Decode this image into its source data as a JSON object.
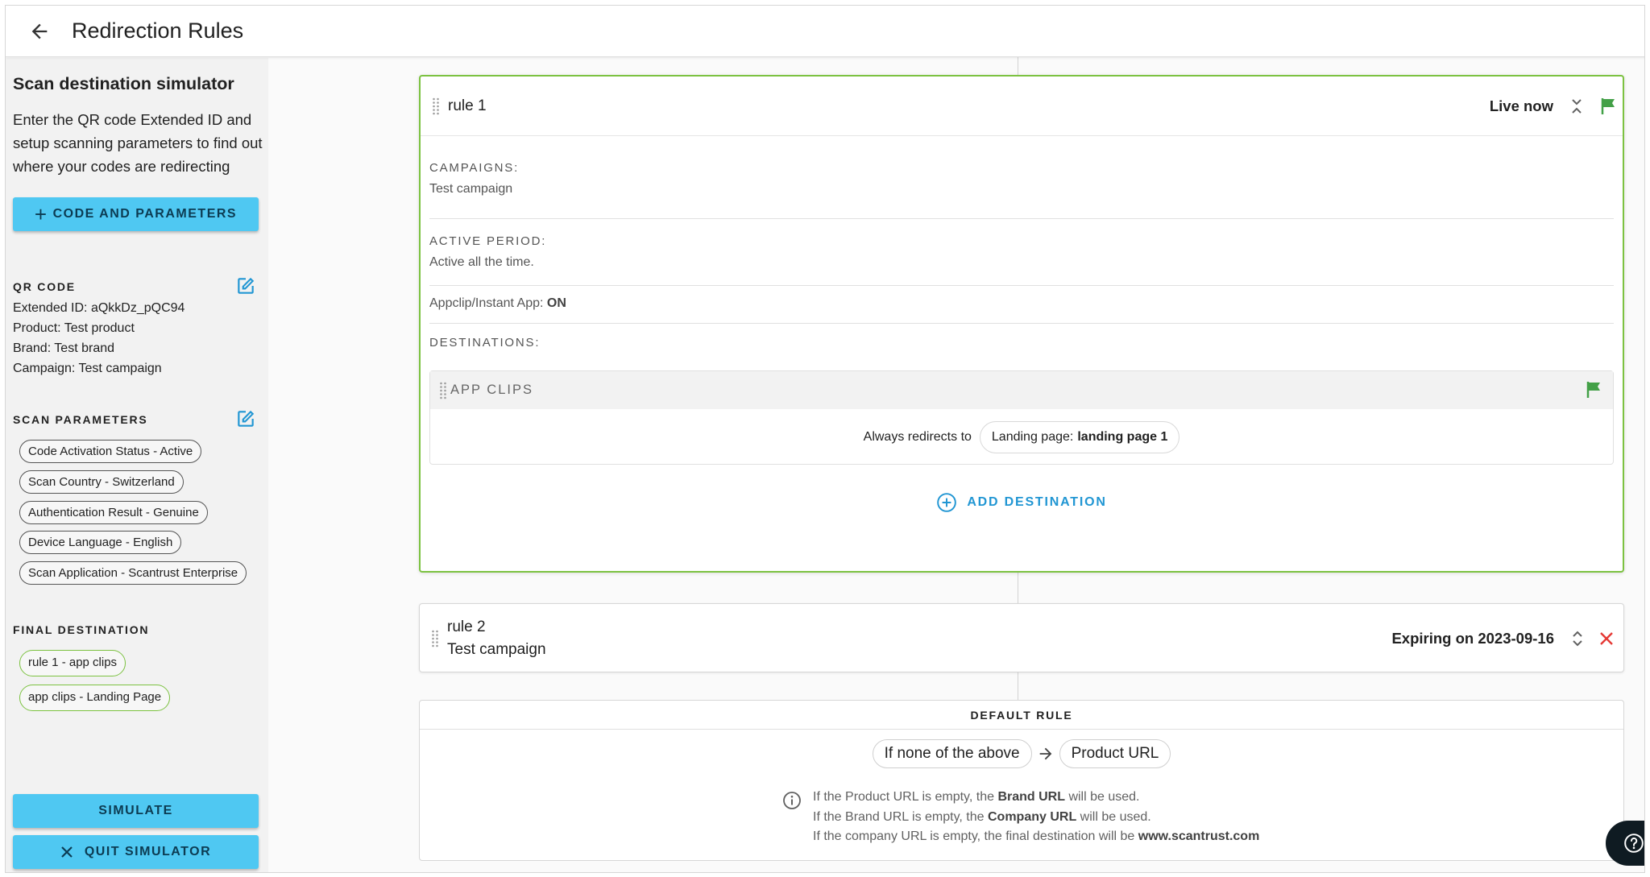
{
  "header": {
    "title": "Redirection Rules"
  },
  "sidebar": {
    "title": "Scan destination simulator",
    "description": "Enter the QR code Extended ID and setup scanning parameters to find out where your codes are redirecting",
    "code_button": "CODE AND PARAMETERS",
    "qr_code": {
      "label": "QR CODE",
      "extended_id": "Extended ID: aQkkDz_pQC94",
      "product": "Product: Test product",
      "brand": "Brand: Test brand",
      "campaign": "Campaign: Test campaign"
    },
    "scan_parameters": {
      "label": "SCAN PARAMETERS",
      "chips": [
        "Code Activation Status - Active",
        "Scan Country - Switzerland",
        "Authentication Result - Genuine",
        "Device Language - English",
        "Scan Application - Scantrust Enterprise"
      ]
    },
    "final_destination": {
      "label": "FINAL DESTINATION",
      "chips": [
        "rule 1 - app clips",
        "app clips - Landing Page"
      ]
    },
    "simulate_button": "SIMULATE",
    "quit_button": "QUIT SIMULATOR"
  },
  "rules": [
    {
      "name": "rule 1",
      "status": "Live now",
      "campaigns_label": "CAMPAIGNS:",
      "campaigns_value": "Test campaign",
      "active_period_label": "ACTIVE PERIOD:",
      "active_period_value": "Active all the time.",
      "appclip_label": "Appclip/Instant App:",
      "appclip_value": "ON",
      "destinations_label": "DESTINATIONS:",
      "destination": {
        "title": "APP CLIPS",
        "redirect_label": "Always redirects to",
        "target_prefix": "Landing page:",
        "target_value": "landing page 1"
      },
      "add_destination": "ADD DESTINATION"
    },
    {
      "name": "rule 2",
      "campaign": "Test campaign",
      "status": "Expiring on 2023-09-16"
    }
  ],
  "default_rule": {
    "title": "DEFAULT RULE",
    "condition": "If none of the above",
    "target": "Product URL",
    "notes": [
      {
        "pre": "If the Product URL is empty, the ",
        "bold": "Brand URL",
        "post": " will be used."
      },
      {
        "pre": "If the Brand URL is empty, the ",
        "bold": "Company URL",
        "post": " will be used."
      },
      {
        "pre": "If the company URL is empty, the final destination will be ",
        "bold": "www.scantrust.com",
        "post": ""
      }
    ]
  },
  "colors": {
    "accent_button": "#4fc8f2",
    "live_border": "#7cc241",
    "flag_green": "#43a047",
    "delete_red": "#e53935",
    "link_blue": "#2196d3",
    "edit_icon_blue": "#2196d3"
  },
  "icons": [
    "back-arrow-icon",
    "plus-icon",
    "edit-icon",
    "drag-handle-icon",
    "collapse-icon",
    "expand-icon",
    "flag-icon",
    "close-icon",
    "add-circle-icon",
    "arrow-right-icon",
    "info-icon",
    "help-icon"
  ]
}
